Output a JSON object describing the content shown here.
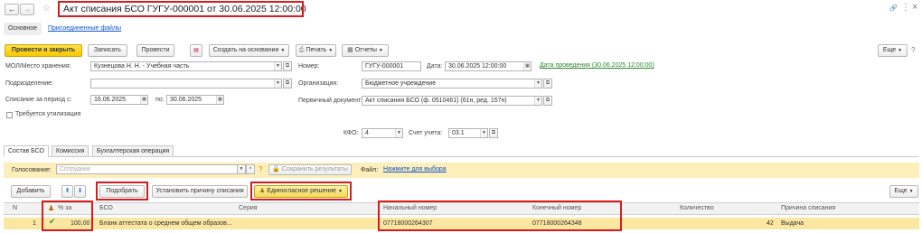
{
  "window": {
    "title": "Акт списания БСО ГУГУ-000001 от 30.06.2025 12:00:00",
    "back": "←",
    "forward": "→",
    "star": "☆",
    "link_icon": "🔗",
    "menu_icon": "⋮",
    "close_icon": "×"
  },
  "subtabs": {
    "main": "Основное",
    "files": "Присоединенные файлы"
  },
  "toolbar": {
    "post_close": "Провести и закрыть",
    "save": "Записать",
    "post": "Провести",
    "create_based": "Создать на основании",
    "print": "Печать",
    "reports": "Отчеты",
    "more": "Еще"
  },
  "form": {
    "mol_label": "МОЛ/Место хранения:",
    "mol_value": "Кузнецова Н. Н. - Учебная часть",
    "dept_label": "Подразделение:",
    "dept_value": "",
    "period_label": "Списание за период с:",
    "period_from": "16.06.2025",
    "period_to_label": "по:",
    "period_to": "30.06.2025",
    "disposal_label": "Требуется утилизация",
    "number_label": "Номер:",
    "number_value": "ГУГУ-000001",
    "date_label": "Дата:",
    "date_value": "30.06.2025 12:00:00",
    "posting_date": "Дата проведения (30.06.2025 12:00:00)",
    "org_label": "Организация:",
    "org_value": "Бюджетное учреждение",
    "primary_doc_label": "Первичный документ:",
    "primary_doc_value": "Акт списания БСО (ф. 0510461) (61н, ред. 157н)",
    "kfo_label": "КФО:",
    "kfo_value": "4",
    "account_label": "Счет учета:",
    "account_value": "03.1"
  },
  "tabs": [
    "Состав БСО",
    "Комиссия",
    "Бухгалтерская операция"
  ],
  "voting": {
    "label": "Голосование:",
    "placeholder": "Сотрудник",
    "save_results": "Сохранить результаты",
    "file_label": "Файл:",
    "file_link": "Нажмите для выбора"
  },
  "table_toolbar": {
    "add": "Добавить",
    "up": "⬆",
    "down": "⬇",
    "pick": "Подобрать",
    "set_reason": "Установить причину списания",
    "unanimous": "Единогласное решение",
    "more": "Еще"
  },
  "table": {
    "columns": [
      "N",
      "% за",
      "БСО",
      "Серия",
      "Начальный номер",
      "Конечный номер",
      "Количество",
      "Причина списания"
    ],
    "rows": [
      {
        "n": "1",
        "pct": "100,00",
        "bso": "Бланк аттестата о среднем общем образов...",
        "series": "",
        "start": "07718000264307",
        "end": "07718000264348",
        "qty": "42",
        "reason": "Выдача"
      }
    ]
  },
  "colors": {
    "accent": "#f6c800",
    "red": "#d61c1c",
    "link": "#1155cc"
  }
}
